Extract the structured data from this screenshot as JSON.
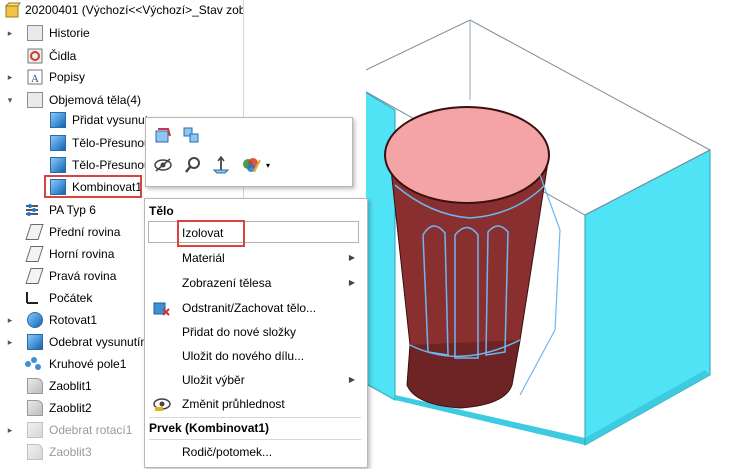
{
  "tree": {
    "root_label": "20200401  (Výchozí<<Výchozí>_Stav zob",
    "items": [
      {
        "label": "Historie"
      },
      {
        "label": "Čidla"
      },
      {
        "label": "Popisy"
      },
      {
        "label": "Objemová těla(4)"
      },
      {
        "label": "Přidat vysunut"
      },
      {
        "label": "Tělo-Přesunou"
      },
      {
        "label": "Tělo-Přesunou"
      },
      {
        "label": "Kombinovat1"
      },
      {
        "label": "PA Typ 6"
      },
      {
        "label": "Přední rovina"
      },
      {
        "label": "Horní rovina"
      },
      {
        "label": "Pravá rovina"
      },
      {
        "label": "Počátek"
      },
      {
        "label": "Rotovat1"
      },
      {
        "label": "Odebrat vysunutím"
      },
      {
        "label": "Kruhové pole1"
      },
      {
        "label": "Zaoblit1"
      },
      {
        "label": "Zaoblit2"
      },
      {
        "label": "Odebrat rotací1"
      },
      {
        "label": "Zaoblit3"
      }
    ]
  },
  "context_menu": {
    "section_body": "Tělo",
    "items": [
      {
        "label": "Izolovat"
      },
      {
        "label": "Materiál"
      },
      {
        "label": "Zobrazení tělesa"
      },
      {
        "label": "Odstranit/Zachovat tělo..."
      },
      {
        "label": "Přidat do nové složky"
      },
      {
        "label": "Uložit do nového dílu..."
      },
      {
        "label": "Uložit výběr"
      },
      {
        "label": "Změnit průhlednost"
      }
    ],
    "section_feature": "Prvek (Kombinovat1)",
    "feature_items": [
      {
        "label": "Rodič/potomek..."
      }
    ]
  },
  "colors": {
    "highlight_red": "#d9433b",
    "cyan_body": "#4fe3f5",
    "cup_top": "#f4a4a4",
    "cup_body": "#8a2f2f"
  },
  "icons": [
    "zoom-to-selection-icon",
    "edit-part-icon",
    "hide-icon",
    "zoom-icon",
    "normal-to-icon",
    "appearance-icon"
  ]
}
